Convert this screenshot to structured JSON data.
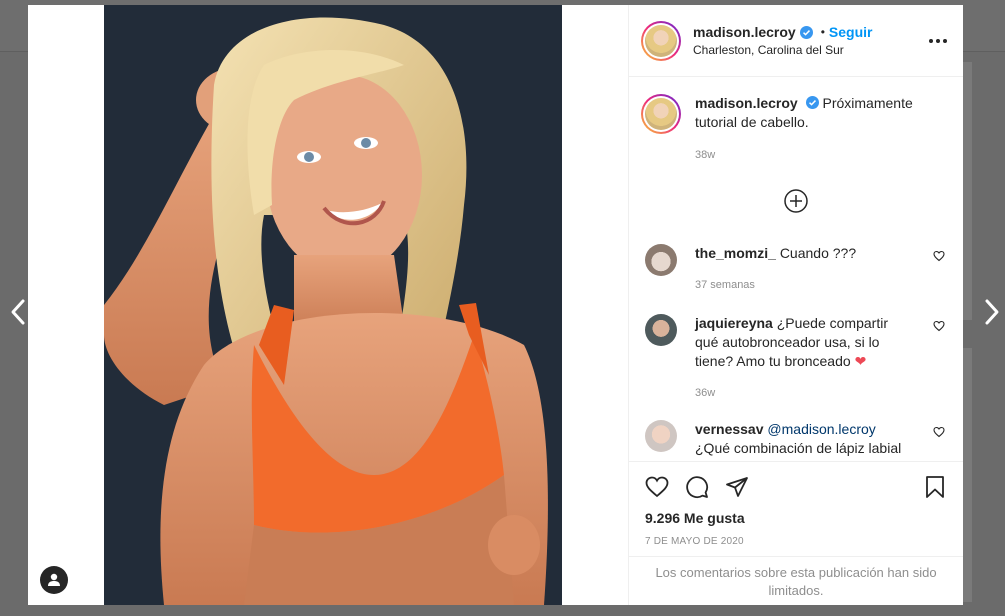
{
  "post": {
    "username": "madison.lecroy",
    "follow_label": "Seguir",
    "separator": "•",
    "location": "Charleston, Carolina del Sur",
    "caption": "Próximamente tutorial de cabello.",
    "caption_time": "38w",
    "likes": "9.296 Me gusta",
    "date": "7 DE MAYO DE 2020",
    "comments_limited": "Los comentarios sobre esta publicación han sido limitados."
  },
  "comments": [
    {
      "user": "the_momzi_",
      "text": "Cuando ???",
      "time": "37 semanas"
    },
    {
      "user": "jaquiereyna",
      "text": "¿Puede compartir qué autobronceador usa, si lo tiene? Amo tu bronceado",
      "emoji": "❤",
      "time": "36w"
    },
    {
      "user": "vernessav",
      "mention": "@madison.lecroy",
      "text": "¿Qué combinación de lápiz labial de"
    }
  ],
  "icons": {
    "verified": "verified-badge-icon",
    "more": "more-options-icon",
    "load_more": "plus-circle-icon",
    "like": "heart-icon",
    "comment": "comment-bubble-icon",
    "share": "paper-plane-icon",
    "save": "bookmark-icon",
    "user_tag": "user-tag-icon"
  },
  "colors": {
    "accent": "#0095f6",
    "muted": "#8e8e8e",
    "text": "#262626",
    "heart": "#ed4956"
  }
}
